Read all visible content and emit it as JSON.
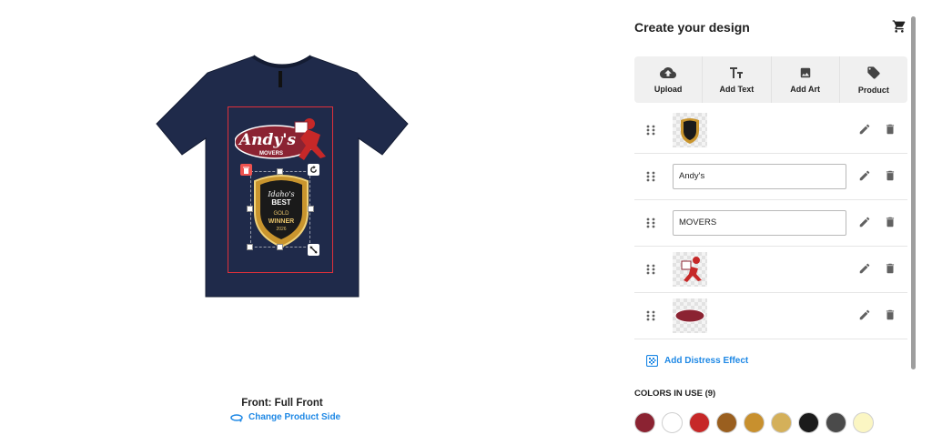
{
  "canvas": {
    "side_label": "Front: Full Front",
    "change_side_label": "Change Product Side",
    "shirt_color": "#1f2a4a",
    "print_area_color": "#e0303a",
    "design": {
      "logo_main_text": "Andy's",
      "logo_sub_text": "MOVERS",
      "badge_line1": "Idaho's",
      "badge_line2": "BEST",
      "badge_line3": "GOLD",
      "badge_line4": "WINNER",
      "badge_line5": "2026"
    }
  },
  "panel": {
    "title": "Create your design",
    "cart_icon": "shopping-cart-icon",
    "tools": [
      {
        "label": "Upload",
        "icon": "cloud-upload-icon"
      },
      {
        "label": "Add Text",
        "icon": "text-fields-icon"
      },
      {
        "label": "Add Art",
        "icon": "image-icon"
      },
      {
        "label": "Product",
        "icon": "tag-icon"
      }
    ],
    "layers": [
      {
        "type": "image",
        "name": "badge"
      },
      {
        "type": "text",
        "value": "Andy's"
      },
      {
        "type": "text",
        "value": "MOVERS"
      },
      {
        "type": "image",
        "name": "mover-figure"
      },
      {
        "type": "image",
        "name": "oval"
      }
    ],
    "distress_label": "Add Distress Effect",
    "colors_label": "COLORS IN USE (9)",
    "colors": [
      "#8b2332",
      "#ffffff",
      "#c62828",
      "#9a5f1f",
      "#c8902e",
      "#d4b05a",
      "#1b1b1b",
      "#4a4a4a",
      "#fbf6c3"
    ]
  },
  "accent": "#1e88e5"
}
